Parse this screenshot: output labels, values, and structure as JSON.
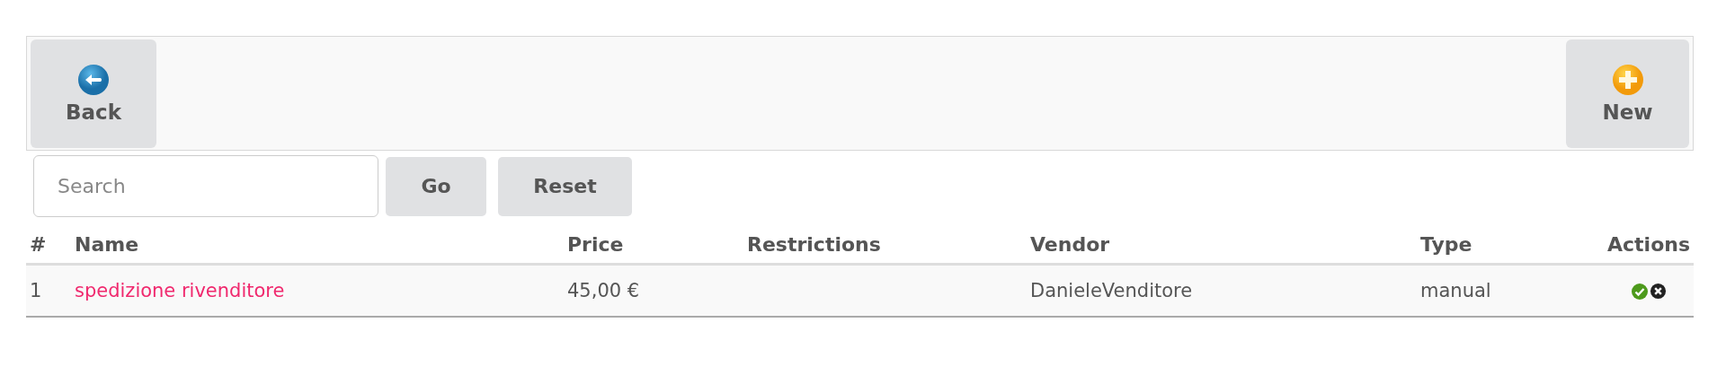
{
  "toolbar": {
    "buttons": [
      {
        "label": "Back",
        "kind": "back"
      },
      {
        "label": "New",
        "kind": "new"
      }
    ]
  },
  "search": {
    "placeholder": "Search",
    "buttons": [
      "Go",
      "Reset"
    ]
  },
  "table": {
    "columns": [
      "#",
      "Name",
      "Price",
      "Restrictions",
      "Vendor",
      "Type",
      "Actions"
    ],
    "rows": [
      {
        "index": "1",
        "name": "spedizione rivenditore",
        "price": "45,00 €",
        "restrictions": "",
        "vendor": "DanieleVenditore",
        "type": "manual"
      }
    ]
  }
}
